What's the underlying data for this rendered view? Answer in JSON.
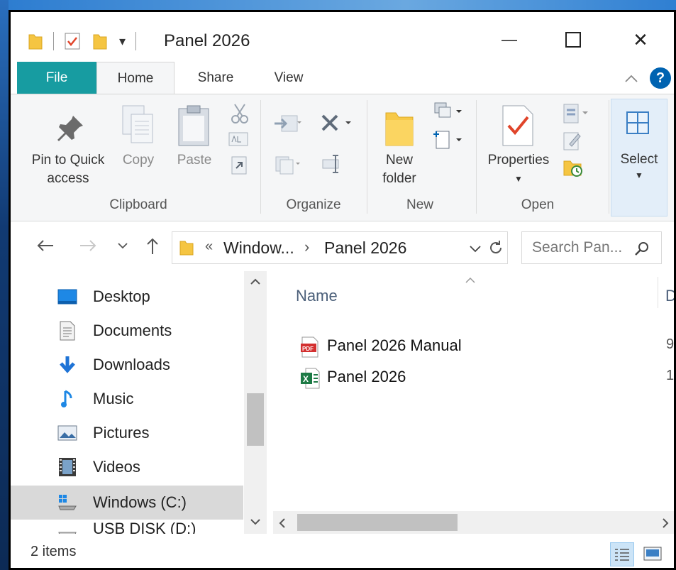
{
  "window": {
    "title": "Panel 2026",
    "minimize_glyph": "—",
    "maximize_glyph": "☐",
    "close_glyph": "✕"
  },
  "quick_access": {
    "customize_glyph": "▾"
  },
  "tabs": [
    {
      "label": "File"
    },
    {
      "label": "Home"
    },
    {
      "label": "Share"
    },
    {
      "label": "View"
    }
  ],
  "ribbon": {
    "clipboard": {
      "group_label": "Clipboard",
      "pin_line1": "Pin to Quick",
      "pin_line2": "access",
      "copy": "Copy",
      "paste": "Paste"
    },
    "organize": {
      "group_label": "Organize"
    },
    "new": {
      "group_label": "New",
      "new_folder_line1": "New",
      "new_folder_line2": "folder"
    },
    "open": {
      "group_label": "Open",
      "properties": "Properties"
    },
    "select": {
      "label": "Select"
    }
  },
  "address": {
    "overflow": "«",
    "crumb1": "Window...",
    "chevron": "›",
    "crumb2": "Panel 2026"
  },
  "search": {
    "placeholder": "Search Pan..."
  },
  "nav": {
    "items": [
      {
        "label": "Desktop",
        "icon": "desktop-icon"
      },
      {
        "label": "Documents",
        "icon": "documents-icon"
      },
      {
        "label": "Downloads",
        "icon": "downloads-icon"
      },
      {
        "label": "Music",
        "icon": "music-icon"
      },
      {
        "label": "Pictures",
        "icon": "pictures-icon"
      },
      {
        "label": "Videos",
        "icon": "videos-icon"
      },
      {
        "label": "Windows (C:)",
        "icon": "drive-icon"
      },
      {
        "label": "USB DISK (D:)",
        "icon": "usb-icon"
      }
    ]
  },
  "content": {
    "col_name": "Name",
    "col_date_partial": "D",
    "files": [
      {
        "name": "Panel 2026 Manual",
        "icon": "pdf-icon",
        "partial": "9"
      },
      {
        "name": "Panel 2026",
        "icon": "excel-icon",
        "partial": "1"
      }
    ]
  },
  "status": {
    "items_count": "2 items"
  },
  "colors": {
    "file_tab": "#179ca1",
    "accent": "#0063b1",
    "selected_nav": "#cce4f7"
  }
}
